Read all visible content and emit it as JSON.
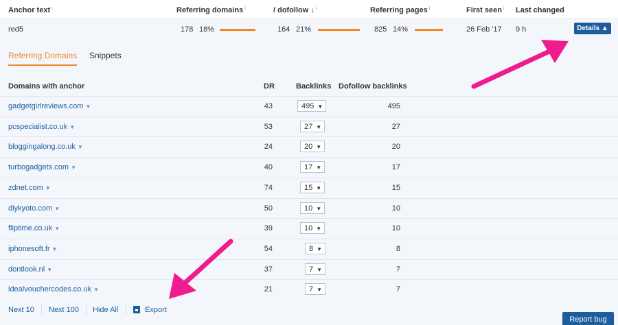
{
  "header": {
    "anchor_text": "Anchor text",
    "referring_domains": "Referring domains",
    "dofollow": "/ dofollow",
    "sort_icon": "↓",
    "referring_pages": "Referring pages",
    "first_seen": "First seen",
    "last_changed": "Last changed",
    "info": "i"
  },
  "anchor_row": {
    "anchor": "red5",
    "ref_domains": "178",
    "ref_domains_pct": "18%",
    "ref_domains_bar": 0.18,
    "dofollow": "164",
    "dofollow_pct": "21%",
    "dofollow_bar": 0.21,
    "ref_pages": "825",
    "ref_pages_pct": "14%",
    "ref_pages_bar": 0.14,
    "first_seen": "26 Feb '17",
    "last_changed": "9 h",
    "details_label": "Details ▲"
  },
  "tabs": [
    "Referring Domains",
    "Snippets"
  ],
  "table": {
    "columns": [
      "Domains with anchor",
      "DR",
      "Backlinks",
      "Dofollow backlinks"
    ],
    "rows": [
      {
        "domain": "gadgetgirlreviews.com",
        "dr": "43",
        "backlinks": "495",
        "dofollow": "495"
      },
      {
        "domain": "pcspecialist.co.uk",
        "dr": "53",
        "backlinks": "27",
        "dofollow": "27"
      },
      {
        "domain": "bloggingalong.co.uk",
        "dr": "24",
        "backlinks": "20",
        "dofollow": "20"
      },
      {
        "domain": "turbogadgets.com",
        "dr": "40",
        "backlinks": "17",
        "dofollow": "17"
      },
      {
        "domain": "zdnet.com",
        "dr": "74",
        "backlinks": "15",
        "dofollow": "15"
      },
      {
        "domain": "diykyoto.com",
        "dr": "50",
        "backlinks": "10",
        "dofollow": "10"
      },
      {
        "domain": "fliptime.co.uk",
        "dr": "39",
        "backlinks": "10",
        "dofollow": "10"
      },
      {
        "domain": "iphonesoft.fr",
        "dr": "54",
        "backlinks": "8",
        "dofollow": "8"
      },
      {
        "domain": "dontlook.nl",
        "dr": "37",
        "backlinks": "7",
        "dofollow": "7"
      },
      {
        "domain": "idealvouchercodes.co.uk",
        "dr": "21",
        "backlinks": "7",
        "dofollow": "7"
      }
    ]
  },
  "footer": {
    "next10": "Next 10",
    "next100": "Next 100",
    "hide_all": "Hide All",
    "export": "Export"
  },
  "report_bug": "Report bug",
  "colors": {
    "accent": "#f4862a",
    "link": "#1d5d9e",
    "annotation": "#ee1c8e",
    "panel_bg": "#f3f7fc"
  }
}
